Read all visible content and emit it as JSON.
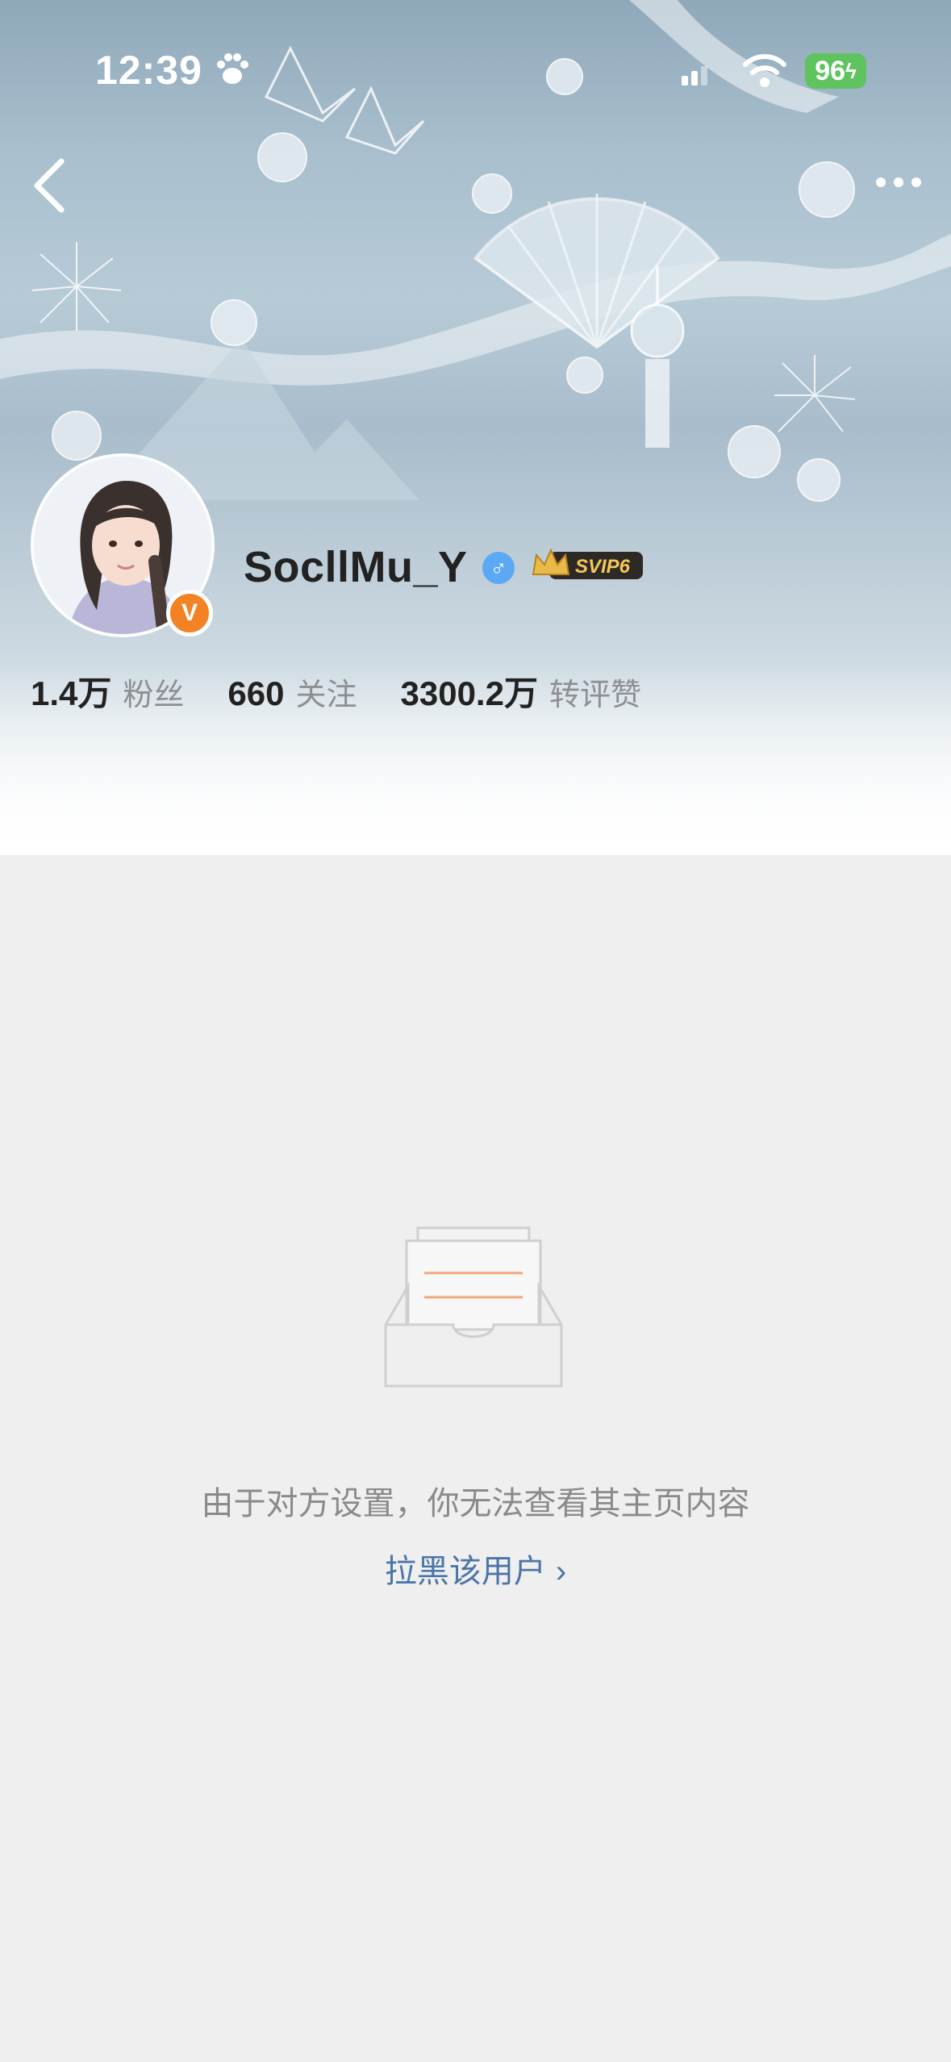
{
  "status_bar": {
    "time": "12:39",
    "battery": "96"
  },
  "nav": {
    "back_icon": "chevron-left-icon",
    "more_icon": "more-dots-icon"
  },
  "profile": {
    "username": "SocllMu_Y",
    "gender_symbol": "♂",
    "verified_badge": "V",
    "vip_badge": "SVIP6",
    "stats": [
      {
        "value": "1.4万",
        "label": "粉丝"
      },
      {
        "value": "660",
        "label": "关注"
      },
      {
        "value": "3300.2万",
        "label": "转评赞"
      }
    ]
  },
  "empty_state": {
    "message": "由于对方设置，你无法查看其主页内容",
    "block_link": "拉黑该用户",
    "link_chevron": "›"
  },
  "colors": {
    "accent": "#4c75a8",
    "verified": "#f28224",
    "gender": "#5aa9f2",
    "battery": "#5fc460",
    "page_bg": "#efefef"
  }
}
